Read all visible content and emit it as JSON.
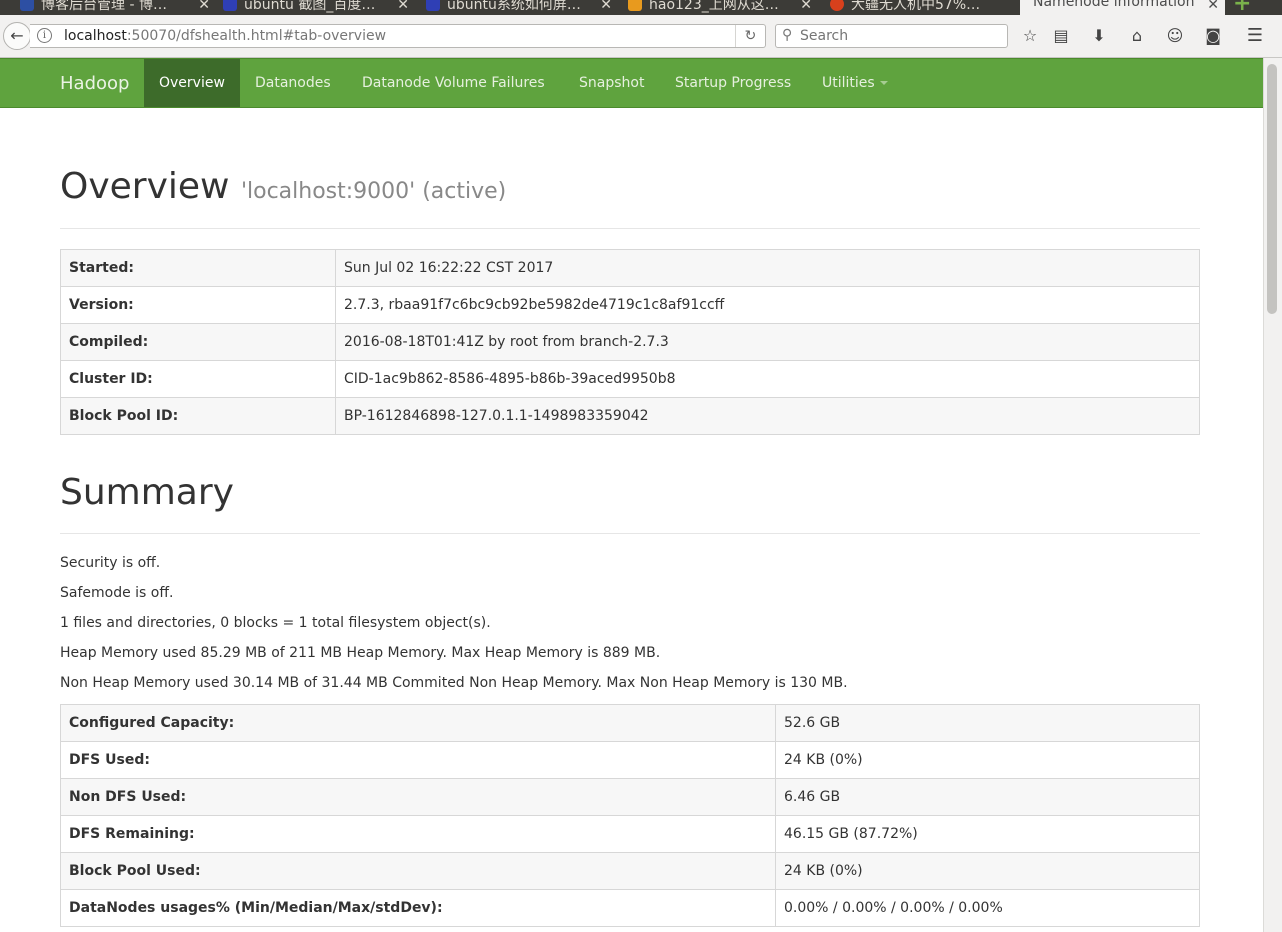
{
  "browser": {
    "tabs": [
      {
        "label": "博客后台管理 - 博…",
        "favicon_color": "#2d4fa3"
      },
      {
        "label": "ubuntu 截图_百度…",
        "favicon_color": "#2f3fb5"
      },
      {
        "label": "ubuntu系统如何屏…",
        "favicon_color": "#2f3fb5"
      },
      {
        "label": "hao123_上网从这…",
        "favicon_color": "#e89a1e"
      },
      {
        "label": "大疆无人机中57%…",
        "favicon_color": "#d8401c"
      },
      {
        "label": "Namenode information",
        "favicon_color": "#f2f1f0"
      }
    ],
    "url_host": "localhost",
    "url_rest": ":50070/dfshealth.html#tab-overview",
    "search_placeholder": "Search"
  },
  "nav": {
    "brand": "Hadoop",
    "items": [
      "Overview",
      "Datanodes",
      "Datanode Volume Failures",
      "Snapshot",
      "Startup Progress",
      "Utilities"
    ],
    "active_color": "#3d6b2a",
    "bar_color": "#5fa33e"
  },
  "overview": {
    "title": "Overview",
    "subtitle": "'localhost:9000' (active)",
    "rows": [
      {
        "key": "Started:",
        "value": "Sun Jul 02 16:22:22 CST 2017"
      },
      {
        "key": "Version:",
        "value": "2.7.3, rbaa91f7c6bc9cb92be5982de4719c1c8af91ccff"
      },
      {
        "key": "Compiled:",
        "value": "2016-08-18T01:41Z by root from branch-2.7.3"
      },
      {
        "key": "Cluster ID:",
        "value": "CID-1ac9b862-8586-4895-b86b-39aced9950b8"
      },
      {
        "key": "Block Pool ID:",
        "value": "BP-1612846898-127.0.1.1-1498983359042"
      }
    ]
  },
  "summary": {
    "title": "Summary",
    "lines": [
      "Security is off.",
      "Safemode is off.",
      "1 files and directories, 0 blocks = 1 total filesystem object(s).",
      "Heap Memory used 85.29 MB of 211 MB Heap Memory. Max Heap Memory is 889 MB.",
      "Non Heap Memory used 30.14 MB of 31.44 MB Commited Non Heap Memory. Max Non Heap Memory is 130 MB."
    ],
    "rows": [
      {
        "key": "Configured Capacity:",
        "value": "52.6 GB"
      },
      {
        "key": "DFS Used:",
        "value": "24 KB (0%)"
      },
      {
        "key": "Non DFS Used:",
        "value": "6.46 GB"
      },
      {
        "key": "DFS Remaining:",
        "value": "46.15 GB (87.72%)"
      },
      {
        "key": "Block Pool Used:",
        "value": "24 KB (0%)"
      },
      {
        "key": "DataNodes usages% (Min/Median/Max/stdDev):",
        "value": "0.00% / 0.00% / 0.00% / 0.00%"
      }
    ]
  }
}
